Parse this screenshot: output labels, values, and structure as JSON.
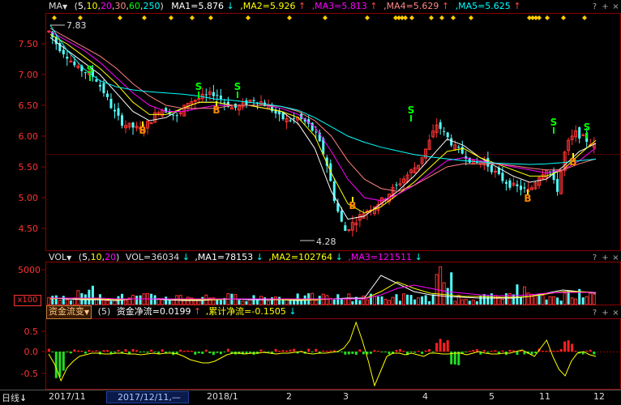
{
  "colors": {
    "bg": "#000000",
    "frame": "#8b0000",
    "up": "#ff3232",
    "down": "#54ffff",
    "ma1": "#ffffff",
    "ma2": "#ffff00",
    "ma3": "#ff00ff",
    "ma4": "#ff8080",
    "ma5": "#00ffff",
    "flow_pos": "#ff2020",
    "flow_neg": "#22dd22",
    "cum_line": "#ffff00",
    "signal_s": "#00ff00",
    "signal_b": "#ff8800"
  },
  "price_panel": {
    "indicator_name": "MA",
    "params": "(5,10,20,30,60,250)",
    "ma1": {
      "label": "MA1=5.876",
      "arrow": "↓"
    },
    "ma2": {
      "label": "MA2=5.926",
      "arrow": "↑"
    },
    "ma3": {
      "label": "MA3=5.813",
      "arrow": "↑"
    },
    "ma4": {
      "label": "MA4=5.629",
      "arrow": "↑"
    },
    "ma5": {
      "label": "MA5=5.625",
      "arrow": "↑"
    },
    "y_ticks": [
      "7.50",
      "7.00",
      "6.50",
      "6.00",
      "5.50",
      "5.00",
      "4.50"
    ],
    "high_label": "7.83",
    "low_label": "4.28",
    "signal_s": "S",
    "signal_b": "B"
  },
  "volume_panel": {
    "indicator_name": "VOL",
    "params": "(5,10,20)",
    "vol": {
      "label": "VOL=36034",
      "arrow": "↓"
    },
    "ma1": {
      "label": "MA1=78153",
      "arrow": "↓"
    },
    "ma2": {
      "label": "MA2=102764",
      "arrow": "↓"
    },
    "ma3": {
      "label": "MA3=121511",
      "arrow": "↓"
    },
    "y_tick": "5000",
    "unit_label": "x100"
  },
  "flow_panel": {
    "indicator_name": "资金流变",
    "params": "(5)",
    "net": {
      "label": "资金净流=0.0199",
      "arrow": "↑"
    },
    "cum": {
      "label": "累计净流=-0.1505",
      "arrow": "↓"
    },
    "y_ticks": [
      "0.5",
      "0.0",
      "-0.5"
    ]
  },
  "time_axis": {
    "period_label": "日线",
    "labels": [
      "2017/11",
      "2017/12/11,—",
      "2018/1",
      "2",
      "3",
      "4",
      "5",
      "11",
      "12"
    ],
    "cursor_label": "2017/12/11,—"
  },
  "panel_buttons": [
    "?",
    "+",
    "×"
  ],
  "chart_data": {
    "type": "candlestick",
    "title": "MA (5,10,20,30,60,250)",
    "ylim": [
      4.2,
      7.9
    ],
    "high": 7.83,
    "low": 4.28,
    "close_series": [
      7.7,
      7.45,
      7.3,
      7.1,
      7.05,
      6.95,
      6.7,
      6.4,
      6.2,
      6.15,
      6.1,
      6.25,
      6.45,
      6.4,
      6.3,
      6.55,
      6.6,
      6.65,
      6.7,
      6.55,
      6.45,
      6.5,
      6.6,
      6.55,
      6.45,
      6.3,
      6.25,
      6.3,
      6.2,
      6.0,
      5.6,
      4.9,
      4.45,
      4.6,
      4.75,
      4.85,
      4.95,
      5.1,
      5.25,
      5.4,
      5.55,
      5.85,
      6.2,
      6.0,
      5.8,
      5.7,
      5.55,
      5.6,
      5.45,
      5.3,
      5.2,
      5.15,
      5.1,
      5.35,
      5.5,
      5.1,
      5.85,
      6.05,
      5.95,
      5.85
    ],
    "ma_series": [
      {
        "name": "MA1",
        "values": [
          7.6,
          7.4,
          7.2,
          7.0,
          6.7,
          6.4,
          6.25,
          6.3,
          6.45,
          6.55,
          6.55,
          6.5,
          6.5,
          6.45,
          6.4,
          6.2,
          5.8,
          5.1,
          4.65,
          4.7,
          4.9,
          5.1,
          5.35,
          5.65,
          5.95,
          5.85,
          5.65,
          5.5,
          5.35,
          5.25,
          5.3,
          5.5,
          5.75,
          5.88
        ]
      },
      {
        "name": "MA2",
        "values": [
          7.65,
          7.5,
          7.3,
          7.1,
          6.85,
          6.55,
          6.35,
          6.35,
          6.45,
          6.55,
          6.55,
          6.5,
          6.5,
          6.45,
          6.4,
          6.3,
          6.0,
          5.4,
          4.9,
          4.75,
          4.85,
          5.05,
          5.25,
          5.5,
          5.75,
          5.8,
          5.65,
          5.55,
          5.45,
          5.35,
          5.35,
          5.45,
          5.7,
          5.93
        ]
      },
      {
        "name": "MA3",
        "values": [
          7.7,
          7.55,
          7.4,
          7.2,
          6.95,
          6.7,
          6.5,
          6.4,
          6.4,
          6.45,
          6.5,
          6.5,
          6.5,
          6.5,
          6.45,
          6.35,
          6.15,
          5.75,
          5.3,
          5.0,
          4.95,
          5.05,
          5.2,
          5.4,
          5.6,
          5.65,
          5.6,
          5.55,
          5.5,
          5.45,
          5.4,
          5.45,
          5.6,
          5.81
        ]
      },
      {
        "name": "MA4",
        "values": [
          7.75,
          7.6,
          7.45,
          7.3,
          7.1,
          6.85,
          6.65,
          6.5,
          6.45,
          6.45,
          6.45,
          6.5,
          6.5,
          6.5,
          6.48,
          6.4,
          6.25,
          6.0,
          5.6,
          5.3,
          5.15,
          5.1,
          5.2,
          5.35,
          5.5,
          5.55,
          5.55,
          5.55,
          5.52,
          5.48,
          5.45,
          5.45,
          5.55,
          5.63
        ]
      },
      {
        "name": "MA5",
        "values": [
          7.8,
          7.4,
          7.1,
          6.9,
          6.8,
          6.75,
          6.72,
          6.7,
          6.68,
          6.65,
          6.6,
          6.58,
          6.55,
          6.52,
          6.48,
          6.42,
          6.3,
          6.15,
          6.0,
          5.9,
          5.82,
          5.76,
          5.7,
          5.66,
          5.63,
          5.6,
          5.58,
          5.56,
          5.55,
          5.54,
          5.55,
          5.57,
          5.6,
          5.625
        ]
      }
    ]
  }
}
